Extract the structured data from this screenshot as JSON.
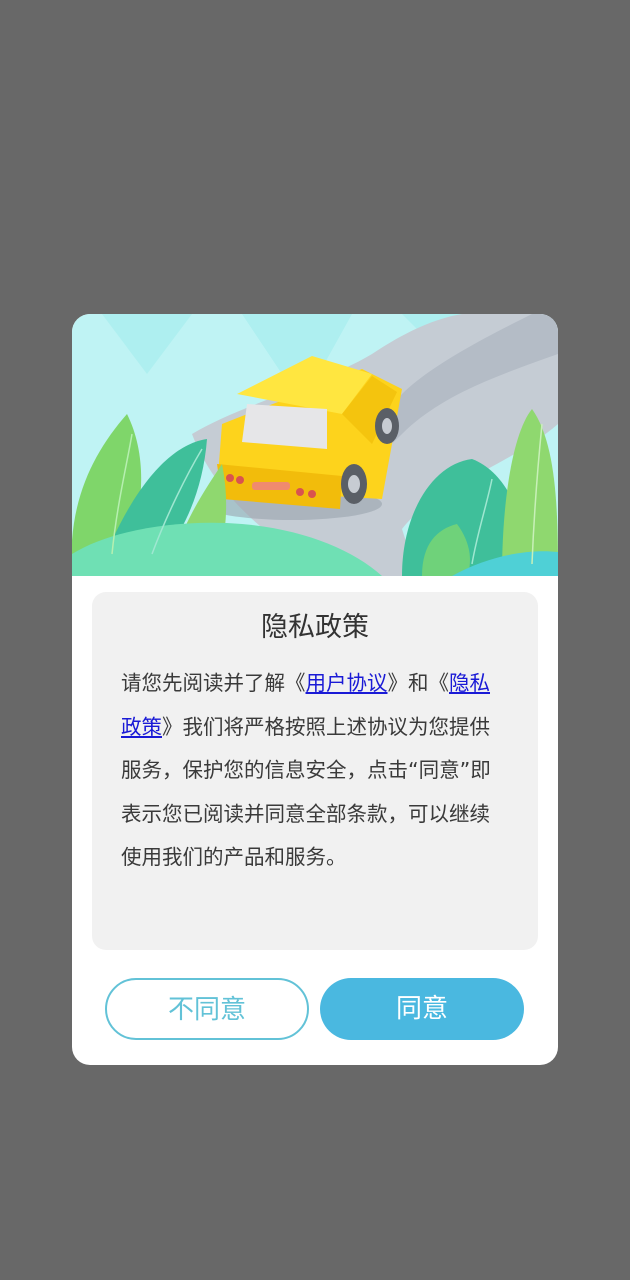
{
  "dialog": {
    "title": "隐私政策",
    "body": {
      "p1": "请您先阅读并了解《",
      "link_user": "用户协议",
      "p2": "》和《",
      "link_privacy": "隐私政策",
      "p3": "》我们将严格按照上述协议为您提供服务，保护您的信息安全，点击“同意”即表示您已阅读并同意全部条款，可以继续使用我们的产品和服务。"
    },
    "disagree_label": "不同意",
    "agree_label": "同意"
  },
  "colors": {
    "overlay": "#686868",
    "link": "#1a1ad6",
    "agree_button": "#4ab8e0",
    "disagree_border": "#62c2d7"
  },
  "icons": {
    "hero": "car-road-illustration"
  }
}
